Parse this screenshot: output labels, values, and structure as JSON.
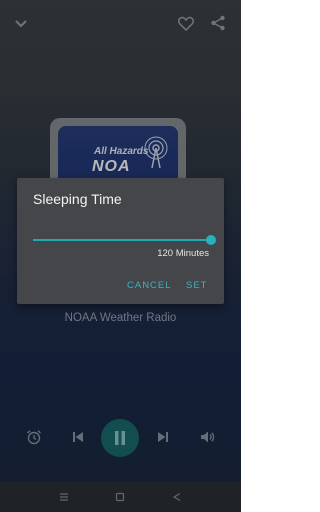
{
  "header": {
    "collapse_icon": "chevron-down-icon",
    "favorite_icon": "heart-outline-icon",
    "share_icon": "share-icon"
  },
  "artwork": {
    "line1": "All Hazards",
    "line2": "NOA"
  },
  "station": {
    "name": "NOAA Weather Radio"
  },
  "controls": {
    "alarm_icon": "alarm-clock-icon",
    "prev_icon": "skip-previous-icon",
    "play_icon": "pause-icon",
    "next_icon": "skip-next-icon",
    "volume_icon": "volume-icon"
  },
  "dialog": {
    "title": "Sleeping Time",
    "value_label": "120 Minutes",
    "slider_fraction": 1.0,
    "cancel_label": "CANCEL",
    "set_label": "SET"
  },
  "navbar": {
    "menu_icon": "menu-lines-icon",
    "home_icon": "home-square-icon",
    "back_icon": "back-triangle-icon"
  },
  "colors": {
    "accent": "#26b3bd",
    "dialog_bg": "#444649"
  }
}
